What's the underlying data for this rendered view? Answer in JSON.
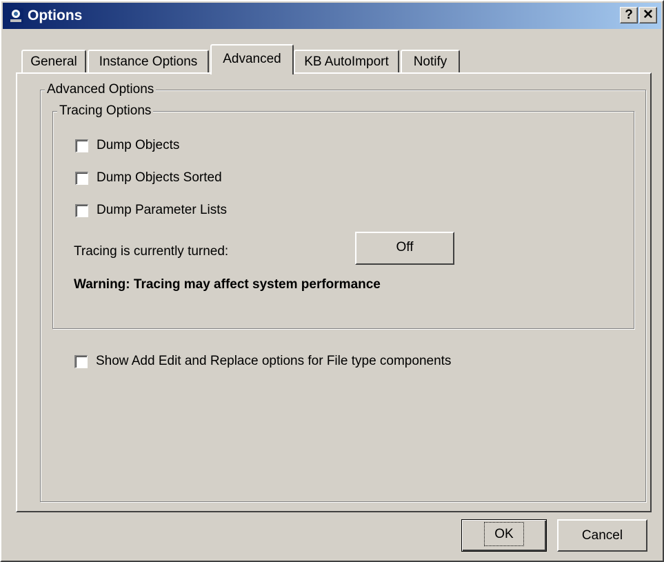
{
  "window": {
    "title": "Options",
    "help_label": "?",
    "close_label": "✕",
    "app_icon": "options-app-icon"
  },
  "tabs": [
    {
      "label": "General",
      "active": false
    },
    {
      "label": "Instance Options",
      "active": false
    },
    {
      "label": "Advanced",
      "active": true
    },
    {
      "label": "KB AutoImport",
      "active": false
    },
    {
      "label": "Notify",
      "active": false
    }
  ],
  "advanced": {
    "group_label": "Advanced Options",
    "tracing": {
      "group_label": "Tracing Options",
      "checkboxes": [
        {
          "label": "Dump Objects",
          "checked": false
        },
        {
          "label": "Dump Objects Sorted",
          "checked": false
        },
        {
          "label": "Dump Parameter Lists",
          "checked": false
        }
      ],
      "status_label": "Tracing is currently turned:",
      "toggle_label": "Off",
      "warning": "Warning:  Tracing may affect system performance"
    },
    "file_options": {
      "label": "Show Add Edit and Replace options for File type components",
      "checked": false
    }
  },
  "buttons": {
    "ok": "OK",
    "cancel": "Cancel"
  }
}
